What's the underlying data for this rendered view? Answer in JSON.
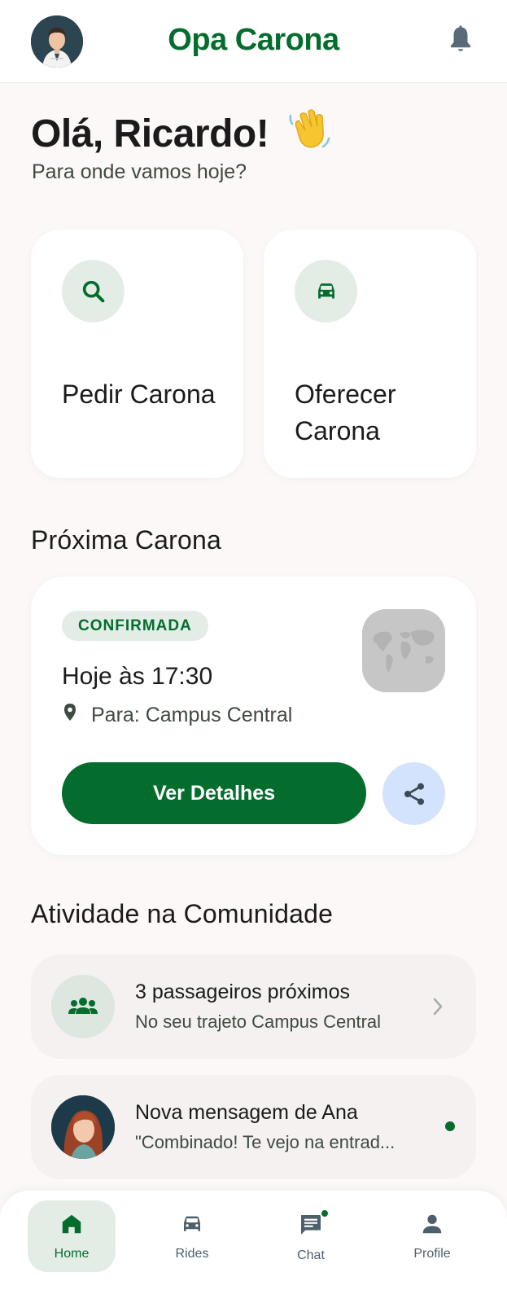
{
  "header": {
    "app_title": "Opa Carona",
    "brand_color": "#046d2e",
    "avatar_icon": "user-avatar",
    "notification_icon": "bell-icon"
  },
  "greeting": {
    "title": "Olá, Ricardo!",
    "emoji": "👋",
    "subtitle": "Para onde vamos hoje?"
  },
  "actions": [
    {
      "label": "Pedir Carona",
      "icon": "search-icon"
    },
    {
      "label": "Oferecer Carona",
      "icon": "car-icon"
    }
  ],
  "next_ride": {
    "section_title": "Próxima Carona",
    "status": "CONFIRMADA",
    "time": "Hoje às 17:30",
    "destination": "Para: Campus Central",
    "details_button": "Ver Detalhes",
    "share_icon": "share-icon"
  },
  "community": {
    "section_title": "Atividade na Comunidade",
    "items": [
      {
        "title": "3 passageiros próximos",
        "subtitle": "No seu trajeto Campus Central",
        "icon": "group-icon"
      },
      {
        "title": "Nova mensagem de Ana",
        "subtitle": "\"Combinado! Te vejo na entrad...",
        "icon": "ana-avatar",
        "unread": true
      }
    ]
  },
  "bottom_nav": {
    "items": [
      {
        "label": "Home",
        "icon": "home-icon",
        "active": true
      },
      {
        "label": "Rides",
        "icon": "car-icon",
        "active": false
      },
      {
        "label": "Chat",
        "icon": "chat-icon",
        "active": false,
        "badge": true
      },
      {
        "label": "Profile",
        "icon": "person-icon",
        "active": false
      }
    ]
  }
}
